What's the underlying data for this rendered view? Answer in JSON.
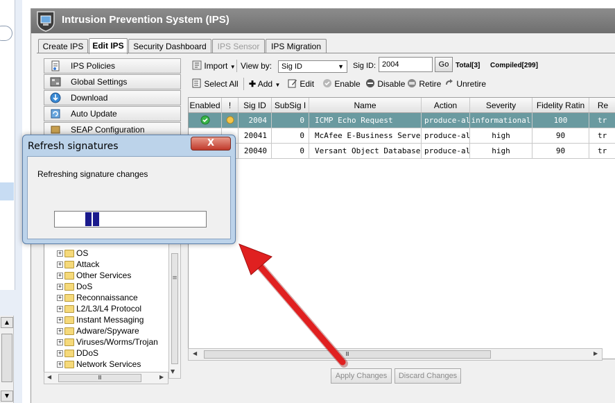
{
  "app": {
    "title": "Intrusion Prevention System (IPS)"
  },
  "tabs": [
    {
      "label": "Create IPS",
      "state": "normal"
    },
    {
      "label": "Edit IPS",
      "state": "active"
    },
    {
      "label": "Security Dashboard",
      "state": "normal"
    },
    {
      "label": "IPS Sensor",
      "state": "disabled"
    },
    {
      "label": "IPS Migration",
      "state": "normal"
    }
  ],
  "nav": {
    "items": [
      {
        "label": "IPS Policies",
        "icon": "policy-icon"
      },
      {
        "label": "Global Settings",
        "icon": "settings-icon"
      },
      {
        "label": "Download",
        "icon": "download-icon"
      },
      {
        "label": "Auto Update",
        "icon": "auto-update-icon"
      },
      {
        "label": "SEAP Configuration",
        "icon": "seap-icon"
      }
    ]
  },
  "tree": {
    "items": [
      "OS",
      "Attack",
      "Other Services",
      "DoS",
      "Reconnaissance",
      "L2/L3/L4 Protocol",
      "Instant Messaging",
      "Adware/Spyware",
      "Viruses/Worms/Trojan",
      "DDoS",
      "Network Services"
    ]
  },
  "toolbar": {
    "import_label": "Import",
    "view_by_label": "View by:",
    "view_by_value": "Sig ID",
    "sig_id_label": "Sig ID:",
    "sig_id_value": "2004",
    "go_label": "Go",
    "total_label": "Total[3]",
    "compiled_label": "Compiled[299]",
    "select_all_label": "Select All",
    "add_label": "Add",
    "edit_label": "Edit",
    "enable_label": "Enable",
    "disable_label": "Disable",
    "retire_label": "Retire",
    "unretire_label": "Unretire"
  },
  "grid": {
    "columns": [
      "Enabled",
      "!",
      "Sig ID",
      "SubSig I",
      "Name",
      "Action",
      "Severity",
      "Fidelity Ratin",
      "Re"
    ],
    "rows": [
      {
        "sig_id": "2004",
        "subsig": "0",
        "name": "ICMP Echo Request",
        "action": "produce-al",
        "severity": "informational",
        "fidelity": "100",
        "re": "tr",
        "selected": true
      },
      {
        "sig_id": "20041",
        "subsig": "0",
        "name": "McAfee E-Business Server",
        "action": "produce-al",
        "severity": "high",
        "fidelity": "90",
        "re": "tr",
        "selected": false
      },
      {
        "sig_id": "20040",
        "subsig": "0",
        "name": "Versant Object Database A",
        "action": "produce-al",
        "severity": "high",
        "fidelity": "90",
        "re": "tr",
        "selected": false
      }
    ]
  },
  "buttons": {
    "apply_label": "Apply Changes",
    "discard_label": "Discard Changes"
  },
  "dialog": {
    "title": "Refresh signatures",
    "close_label": "X",
    "message": "Refreshing signature changes"
  },
  "scroll_glyphs": {
    "grip": "Ⅲ",
    "grip_v": "≡",
    "left": "◀",
    "right": "▶",
    "up": "▲",
    "down": "▼"
  },
  "colors": {
    "selected_row": "#6a9aa0",
    "arrow": "#e02020",
    "progress": "#1a1a8c",
    "dialog_frame": "#bcd3ea"
  }
}
